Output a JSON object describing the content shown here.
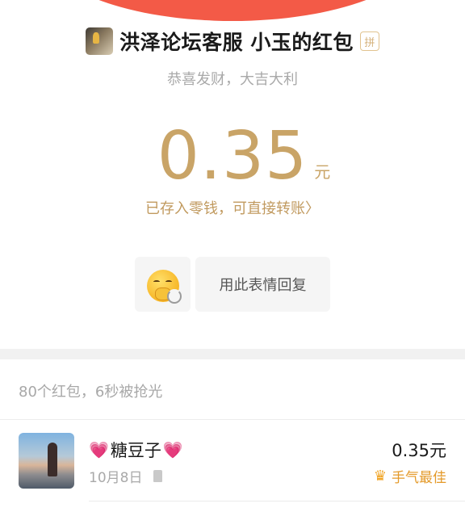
{
  "header": {
    "title": "洪泽论坛客服 小玉的红包",
    "pin_badge": "拼",
    "blessing": "恭喜发财，大吉大利"
  },
  "amount": {
    "value": "0.35",
    "unit": "元",
    "wallet_link": "已存入零钱，可直接转账",
    "chevron": "〉"
  },
  "actions": {
    "reply_label": "用此表情回复",
    "emoji_icon": "hand-over-mouth-emoji",
    "refresh_icon": "refresh-icon"
  },
  "summary": "80个红包，6秒被抢光",
  "records": [
    {
      "name": "糖豆子",
      "heart": "💗",
      "date": "10月8日",
      "amount": "0.35元",
      "best_label": "手气最佳",
      "crown": "♛"
    }
  ],
  "colors": {
    "accent_red": "#f35a47",
    "gold": "#c9a467",
    "best_orange": "#e49a2a"
  }
}
